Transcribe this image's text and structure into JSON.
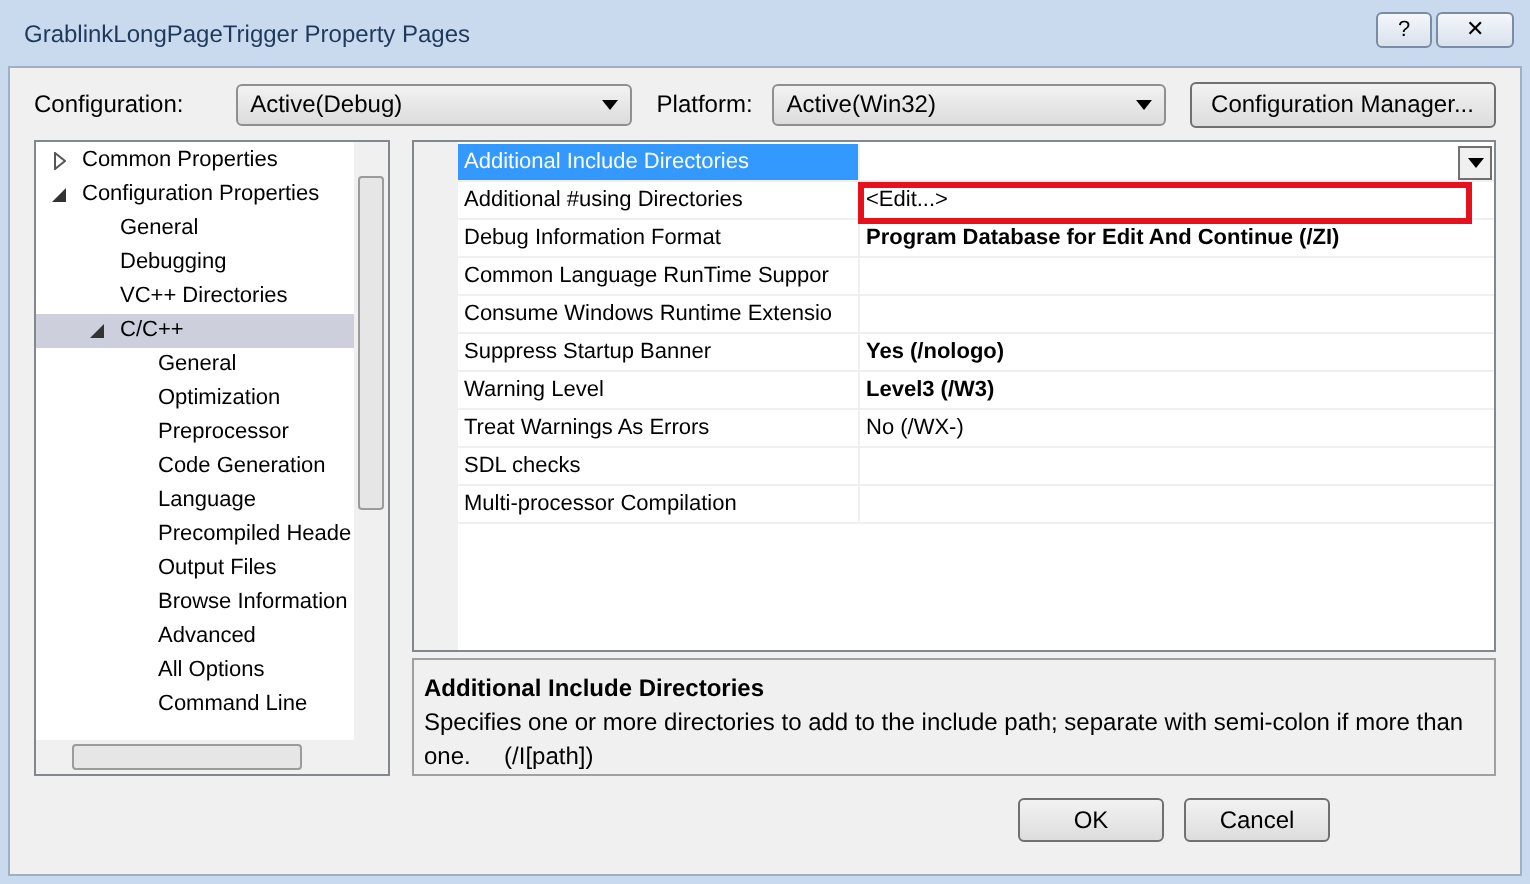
{
  "window": {
    "title": "GrablinkLongPageTrigger Property Pages",
    "buttons": [
      {
        "kind": "help",
        "label": "?"
      },
      {
        "kind": "close",
        "label": "✕"
      }
    ]
  },
  "configuration": {
    "label": "Configuration:",
    "value": "Active(Debug)"
  },
  "platform": {
    "label": "Platform:",
    "value": "Active(Win32)"
  },
  "configuration_manager": "Configuration Manager...",
  "tree": [
    {
      "label": "Common Properties",
      "expanded": false,
      "selected": false
    },
    {
      "label": "Configuration Properties",
      "expanded": true,
      "selected": false,
      "children": [
        {
          "label": "General",
          "selected": false
        },
        {
          "label": "Debugging",
          "selected": false
        },
        {
          "label": "VC++ Directories",
          "selected": false
        },
        {
          "label": "C/C++",
          "expanded": true,
          "selected": true,
          "children": [
            {
              "label": "General",
              "selected": false
            },
            {
              "label": "Optimization",
              "selected": false
            },
            {
              "label": "Preprocessor",
              "selected": false
            },
            {
              "label": "Code Generation",
              "selected": false
            },
            {
              "label": "Language",
              "selected": false
            },
            {
              "label": "Precompiled Heade",
              "selected": false
            },
            {
              "label": "Output Files",
              "selected": false
            },
            {
              "label": "Browse Information",
              "selected": false
            },
            {
              "label": "Advanced",
              "selected": false
            },
            {
              "label": "All Options",
              "selected": false
            },
            {
              "label": "Command Line",
              "selected": false
            }
          ]
        }
      ]
    }
  ],
  "properties": [
    {
      "name": "Additional Include Directories",
      "selected": true,
      "dropdown": true
    },
    {
      "name": "Additional #using Directories",
      "value": "<Edit...>",
      "selected": false
    },
    {
      "name": "Debug Information Format",
      "value": "Program Database for Edit And Continue (/ZI)",
      "selected": false,
      "modified": true
    },
    {
      "name": "Common Language RunTime Suppor",
      "selected": false
    },
    {
      "name": "Consume Windows Runtime Extensio",
      "selected": false
    },
    {
      "name": "Suppress Startup Banner",
      "value": "Yes (/nologo)",
      "selected": false,
      "modified": true
    },
    {
      "name": "Warning Level",
      "value": "Level3 (/W3)",
      "selected": false,
      "modified": true
    },
    {
      "name": "Treat Warnings As Errors",
      "value": "No (/WX-)",
      "selected": false,
      "modified": false
    },
    {
      "name": "SDL checks",
      "selected": false
    },
    {
      "name": "Multi-processor Compilation",
      "selected": false
    }
  ],
  "description": {
    "title": "Additional Include Directories",
    "text": "Specifies one or more directories to add to the include path; separate with semi-colon if more than one.     (/I[path])"
  },
  "buttons": [
    {
      "label": "OK"
    },
    {
      "label": "Cancel"
    }
  ]
}
